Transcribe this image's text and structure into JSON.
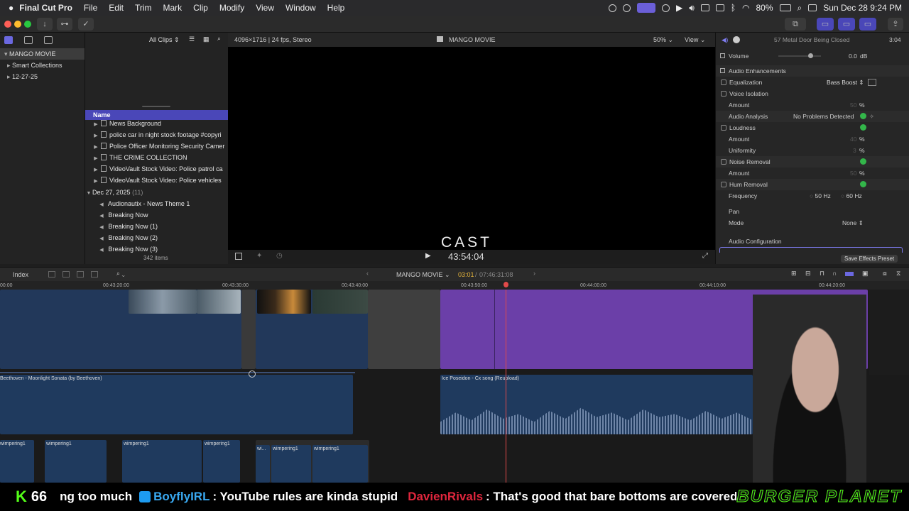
{
  "menubar": {
    "app": "Final Cut Pro",
    "menus": [
      "File",
      "Edit",
      "Trim",
      "Mark",
      "Clip",
      "Modify",
      "View",
      "Window",
      "Help"
    ],
    "battery": "80%",
    "datetime": "Sun Dec 28  9:24 PM"
  },
  "libraries": {
    "items": [
      {
        "label": "MANGO MOVIE",
        "selected": true
      },
      {
        "label": "Smart Collections",
        "selected": false
      },
      {
        "label": "12-27-25",
        "selected": false
      }
    ]
  },
  "browser": {
    "filter": "All Clips",
    "column_header": "Name",
    "items": [
      {
        "label": "News Background",
        "type": "folder"
      },
      {
        "label": "police  car in night stock footage #copyri",
        "type": "clip"
      },
      {
        "label": "Police Officer Monitoring Security Camer",
        "type": "clip"
      },
      {
        "label": "THE CRIME COLLECTION",
        "type": "clip"
      },
      {
        "label": "VideoVault Stock Video:   Police patrol ca",
        "type": "clip"
      },
      {
        "label": "VideoVault Stock Video:   Police vehicles",
        "type": "clip"
      }
    ],
    "group": {
      "label": "Dec 27, 2025",
      "count": "(11)"
    },
    "audio_items": [
      "Audionautix - News Theme 1",
      "Breaking Now",
      "Breaking Now (1)",
      "Breaking Now (2)",
      "Breaking Now (3)"
    ],
    "count": "342 items"
  },
  "viewer": {
    "format": "4096×1716 | 24 fps, Stereo",
    "project": "MANGO MOVIE",
    "zoom": "50%",
    "view_menu": "View",
    "title_text": "CAST",
    "timecode": "43:54:04"
  },
  "inspector": {
    "clip_name": "57 Metal Door Being Closed",
    "duration": "3:04",
    "volume": {
      "label": "Volume",
      "value": "0.0",
      "unit": "dB"
    },
    "section": "Audio Enhancements",
    "equalization": {
      "label": "Equalization",
      "value": "Bass Boost"
    },
    "voice_isolation": "Voice Isolation",
    "amount_label": "Amount",
    "vi_amount": "50",
    "analysis": {
      "label": "Audio Analysis",
      "value": "No Problems Detected"
    },
    "loudness": "Loudness",
    "loud_amount": "40",
    "uniformity": {
      "label": "Uniformity",
      "value": "3"
    },
    "noise_removal": "Noise Removal",
    "noise_amount": "50",
    "hum_removal": "Hum Removal",
    "frequency": {
      "label": "Frequency",
      "opt1": "50 Hz",
      "opt2": "60 Hz"
    },
    "pan": "Pan",
    "mode": {
      "label": "Mode",
      "value": "None"
    },
    "audio_config": "Audio Configuration",
    "save_preset": "Save Effects Preset",
    "percent": "%"
  },
  "timeline": {
    "index": "Index",
    "project": "MANGO MOVIE",
    "position": "03:01",
    "total": "07:46:31:08",
    "ruler": [
      "00:00",
      "00:43:20:00",
      "00:43:30:00",
      "00:43:40:00",
      "00:43:50:00",
      "00:44:00:00",
      "00:44:10:00",
      "00:44:20:00"
    ],
    "audio1": "Beethoven - Moonlight Sonata (by Beethoven)",
    "audio2": "Ice Poseidon - Cx song (Reupload)",
    "sfx": [
      "wimpering1",
      "wimpering1",
      "wimpering1",
      "wimpering1",
      "wi...",
      "wimpering1",
      "wimpering1"
    ]
  },
  "ticker": {
    "kick_count": "66",
    "msg_prefix": "ng too much",
    "user1": "BoyflyIRL",
    "msg1": ": YouTube rules are kinda stupid",
    "user2": "DavienRivals",
    "msg2": ": That's good that bare bottoms are covered",
    "brand": "BURGER PLANET"
  }
}
